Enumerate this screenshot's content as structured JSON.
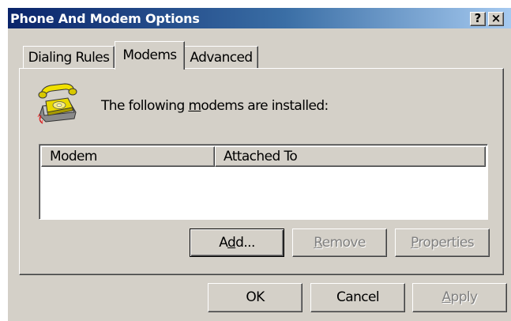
{
  "window": {
    "title": "Phone And Modem Options",
    "help_glyph": "?",
    "close_glyph": "×"
  },
  "tabs": [
    {
      "label": "Dialing Rules",
      "active": false
    },
    {
      "label": "Modems",
      "active": true
    },
    {
      "label": "Advanced",
      "active": false
    }
  ],
  "modems_tab": {
    "icon": "telephone-icon",
    "installed_label_pre": "The following ",
    "installed_label_u": "m",
    "installed_label_post": "odems are  installed:",
    "columns": [
      "Modem",
      "Attached To"
    ],
    "rows": [],
    "add_button": {
      "pre": "A",
      "u": "d",
      "post": "d..."
    },
    "remove_button": {
      "pre": "",
      "u": "R",
      "post": "emove",
      "disabled": true
    },
    "properties_button": {
      "pre": "",
      "u": "P",
      "post": "roperties",
      "disabled": true
    }
  },
  "footer": {
    "ok_label": "OK",
    "cancel_label": "Cancel",
    "apply_button": {
      "pre": "",
      "u": "A",
      "post": "pply",
      "disabled": true
    }
  },
  "colors": {
    "face": "#d4d0c8",
    "titlebar_start": "#0a246a",
    "titlebar_end": "#a6caf0"
  }
}
